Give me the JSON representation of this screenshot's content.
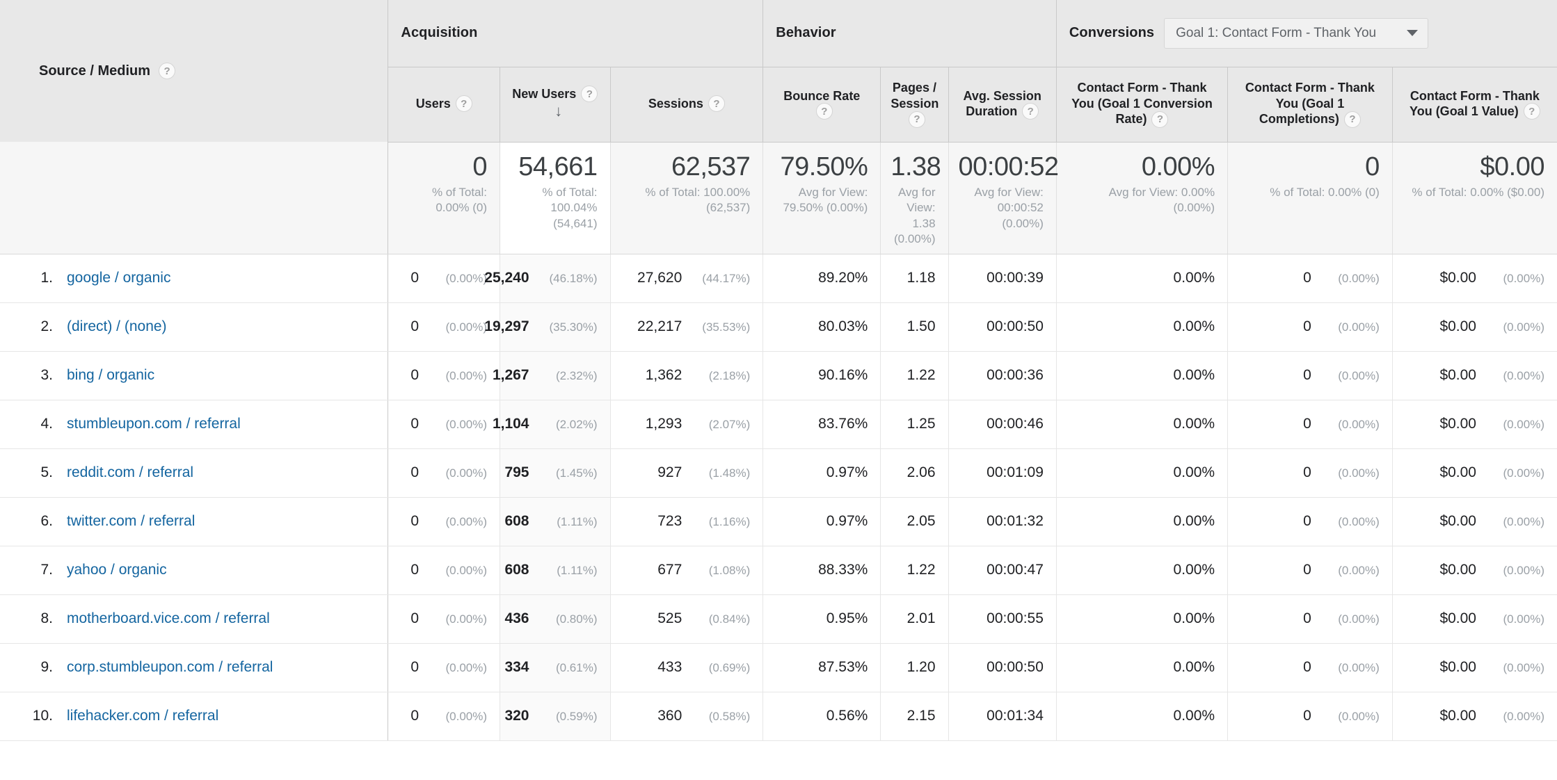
{
  "groups": {
    "dimension_label": "Source / Medium",
    "acquisition": "Acquisition",
    "behavior": "Behavior",
    "conversions": "Conversions",
    "goal_select_value": "Goal 1: Contact Form - Thank You"
  },
  "columns": {
    "users": "Users",
    "new_users": "New Users",
    "sessions": "Sessions",
    "bounce_rate": "Bounce Rate",
    "pages_session": "Pages / Session",
    "avg_duration": "Avg. Session Duration",
    "goal_conv_rate": "Contact Form - Thank You (Goal 1 Conversion Rate)",
    "goal_completions": "Contact Form - Thank You (Goal 1 Completions)",
    "goal_value": "Contact Form - Thank You (Goal 1 Value)",
    "sort_indicator": "↓"
  },
  "icons": {
    "help": "?",
    "sort_descending": "sort-descending-icon",
    "dropdown_caret": "chevron-down-icon"
  },
  "summary": {
    "users": {
      "value": "0",
      "sub": "% of Total: 0.00% (0)"
    },
    "new_users": {
      "value": "54,661",
      "sub": "% of Total: 100.04% (54,641)"
    },
    "sessions": {
      "value": "62,537",
      "sub": "% of Total: 100.00% (62,537)"
    },
    "bounce_rate": {
      "value": "79.50%",
      "sub": "Avg for View: 79.50% (0.00%)"
    },
    "pages_session": {
      "value": "1.38",
      "sub": "Avg for View: 1.38 (0.00%)"
    },
    "avg_duration": {
      "value": "00:00:52",
      "sub": "Avg for View: 00:00:52 (0.00%)"
    },
    "goal_conv_rate": {
      "value": "0.00%",
      "sub": "Avg for View: 0.00% (0.00%)"
    },
    "goal_completions": {
      "value": "0",
      "sub": "% of Total: 0.00% (0)"
    },
    "goal_value": {
      "value": "$0.00",
      "sub": "% of Total: 0.00% ($0.00)"
    }
  },
  "rows": [
    {
      "rank": "1.",
      "source": "google / organic",
      "users": "0",
      "users_pct": "(0.00%)",
      "new_users": "25,240",
      "new_users_pct": "(46.18%)",
      "sessions": "27,620",
      "sessions_pct": "(44.17%)",
      "bounce_rate": "89.20%",
      "pages_session": "1.18",
      "avg_duration": "00:00:39",
      "goal_conv_rate": "0.00%",
      "goal_completions": "0",
      "goal_completions_pct": "(0.00%)",
      "goal_value": "$0.00",
      "goal_value_pct": "(0.00%)"
    },
    {
      "rank": "2.",
      "source": "(direct) / (none)",
      "users": "0",
      "users_pct": "(0.00%)",
      "new_users": "19,297",
      "new_users_pct": "(35.30%)",
      "sessions": "22,217",
      "sessions_pct": "(35.53%)",
      "bounce_rate": "80.03%",
      "pages_session": "1.50",
      "avg_duration": "00:00:50",
      "goal_conv_rate": "0.00%",
      "goal_completions": "0",
      "goal_completions_pct": "(0.00%)",
      "goal_value": "$0.00",
      "goal_value_pct": "(0.00%)"
    },
    {
      "rank": "3.",
      "source": "bing / organic",
      "users": "0",
      "users_pct": "(0.00%)",
      "new_users": "1,267",
      "new_users_pct": "(2.32%)",
      "sessions": "1,362",
      "sessions_pct": "(2.18%)",
      "bounce_rate": "90.16%",
      "pages_session": "1.22",
      "avg_duration": "00:00:36",
      "goal_conv_rate": "0.00%",
      "goal_completions": "0",
      "goal_completions_pct": "(0.00%)",
      "goal_value": "$0.00",
      "goal_value_pct": "(0.00%)"
    },
    {
      "rank": "4.",
      "source": "stumbleupon.com / referral",
      "users": "0",
      "users_pct": "(0.00%)",
      "new_users": "1,104",
      "new_users_pct": "(2.02%)",
      "sessions": "1,293",
      "sessions_pct": "(2.07%)",
      "bounce_rate": "83.76%",
      "pages_session": "1.25",
      "avg_duration": "00:00:46",
      "goal_conv_rate": "0.00%",
      "goal_completions": "0",
      "goal_completions_pct": "(0.00%)",
      "goal_value": "$0.00",
      "goal_value_pct": "(0.00%)"
    },
    {
      "rank": "5.",
      "source": "reddit.com / referral",
      "users": "0",
      "users_pct": "(0.00%)",
      "new_users": "795",
      "new_users_pct": "(1.45%)",
      "sessions": "927",
      "sessions_pct": "(1.48%)",
      "bounce_rate": "0.97%",
      "pages_session": "2.06",
      "avg_duration": "00:01:09",
      "goal_conv_rate": "0.00%",
      "goal_completions": "0",
      "goal_completions_pct": "(0.00%)",
      "goal_value": "$0.00",
      "goal_value_pct": "(0.00%)"
    },
    {
      "rank": "6.",
      "source": "twitter.com / referral",
      "users": "0",
      "users_pct": "(0.00%)",
      "new_users": "608",
      "new_users_pct": "(1.11%)",
      "sessions": "723",
      "sessions_pct": "(1.16%)",
      "bounce_rate": "0.97%",
      "pages_session": "2.05",
      "avg_duration": "00:01:32",
      "goal_conv_rate": "0.00%",
      "goal_completions": "0",
      "goal_completions_pct": "(0.00%)",
      "goal_value": "$0.00",
      "goal_value_pct": "(0.00%)"
    },
    {
      "rank": "7.",
      "source": "yahoo / organic",
      "users": "0",
      "users_pct": "(0.00%)",
      "new_users": "608",
      "new_users_pct": "(1.11%)",
      "sessions": "677",
      "sessions_pct": "(1.08%)",
      "bounce_rate": "88.33%",
      "pages_session": "1.22",
      "avg_duration": "00:00:47",
      "goal_conv_rate": "0.00%",
      "goal_completions": "0",
      "goal_completions_pct": "(0.00%)",
      "goal_value": "$0.00",
      "goal_value_pct": "(0.00%)"
    },
    {
      "rank": "8.",
      "source": "motherboard.vice.com / referral",
      "users": "0",
      "users_pct": "(0.00%)",
      "new_users": "436",
      "new_users_pct": "(0.80%)",
      "sessions": "525",
      "sessions_pct": "(0.84%)",
      "bounce_rate": "0.95%",
      "pages_session": "2.01",
      "avg_duration": "00:00:55",
      "goal_conv_rate": "0.00%",
      "goal_completions": "0",
      "goal_completions_pct": "(0.00%)",
      "goal_value": "$0.00",
      "goal_value_pct": "(0.00%)"
    },
    {
      "rank": "9.",
      "source": "corp.stumbleupon.com / referral",
      "users": "0",
      "users_pct": "(0.00%)",
      "new_users": "334",
      "new_users_pct": "(0.61%)",
      "sessions": "433",
      "sessions_pct": "(0.69%)",
      "bounce_rate": "87.53%",
      "pages_session": "1.20",
      "avg_duration": "00:00:50",
      "goal_conv_rate": "0.00%",
      "goal_completions": "0",
      "goal_completions_pct": "(0.00%)",
      "goal_value": "$0.00",
      "goal_value_pct": "(0.00%)"
    },
    {
      "rank": "10.",
      "source": "lifehacker.com / referral",
      "users": "0",
      "users_pct": "(0.00%)",
      "new_users": "320",
      "new_users_pct": "(0.59%)",
      "sessions": "360",
      "sessions_pct": "(0.58%)",
      "bounce_rate": "0.56%",
      "pages_session": "2.15",
      "avg_duration": "00:01:34",
      "goal_conv_rate": "0.00%",
      "goal_completions": "0",
      "goal_completions_pct": "(0.00%)",
      "goal_value": "$0.00",
      "goal_value_pct": "(0.00%)"
    }
  ],
  "colors": {
    "link": "#1465a0",
    "header_bg": "#e8e8e8",
    "summary_bg": "#f6f6f6",
    "sorted_col_bg": "#fafafa",
    "muted_text": "#9aa0a6"
  }
}
